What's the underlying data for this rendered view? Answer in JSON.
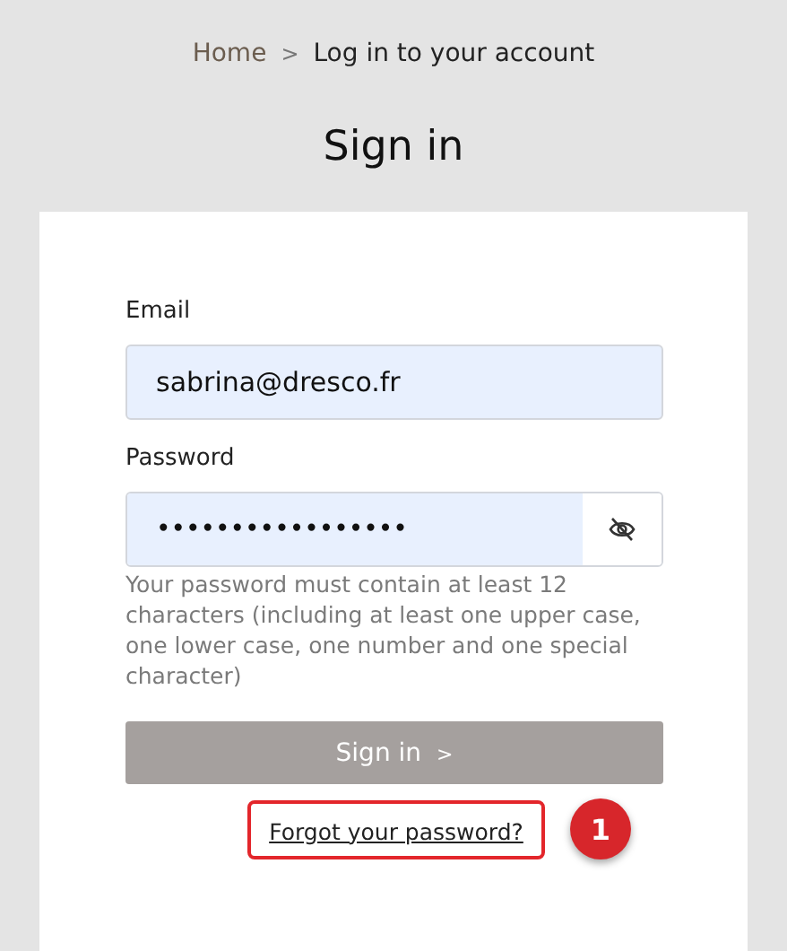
{
  "breadcrumb": {
    "items": [
      "Home",
      "Log in to your account"
    ],
    "separator": ">"
  },
  "title": "Sign in",
  "form": {
    "email": {
      "label": "Email",
      "value": "sabrina@dresco.fr"
    },
    "password": {
      "label": "Password",
      "value": "•••••••••••••••••",
      "hint": "Your password must contain at least 12 characters (including at least one upper case, one lower case, one number and one special character)"
    },
    "submit": {
      "label": "Sign in",
      "chevron": ">"
    },
    "forgot_link": "Forgot your password?"
  },
  "annotation": {
    "number": "1"
  }
}
